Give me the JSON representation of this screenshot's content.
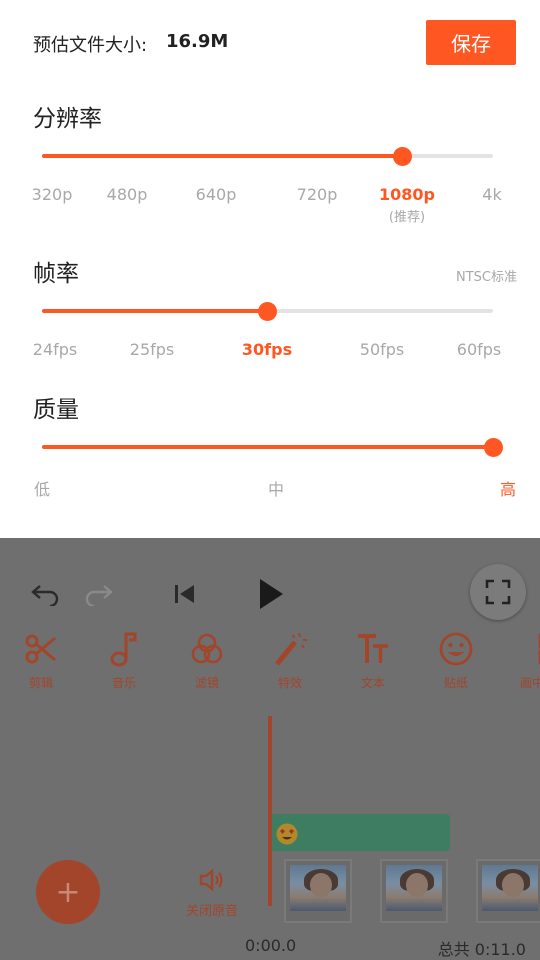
{
  "export": {
    "size_label": "预估文件大小:",
    "size_value": "16.9M",
    "save_label": "保存"
  },
  "resolution": {
    "title": "分辨率",
    "options": [
      "320p",
      "480p",
      "640p",
      "720p",
      "1080p",
      "4k"
    ],
    "selected": "1080p",
    "selected_note": "(推荐)",
    "level": 0.8
  },
  "framerate": {
    "title": "帧率",
    "note": "NTSC标准",
    "options": [
      "24fps",
      "25fps",
      "30fps",
      "50fps",
      "60fps"
    ],
    "selected": "30fps",
    "level": 0.5
  },
  "quality": {
    "title": "质量",
    "options": [
      "低",
      "中",
      "高"
    ],
    "selected": "高",
    "level": 1.0
  },
  "editor": {
    "tools": [
      {
        "label": "剪辑",
        "icon": "scissors-icon"
      },
      {
        "label": "音乐",
        "icon": "music-note-icon"
      },
      {
        "label": "滤镜",
        "icon": "filter-circles-icon"
      },
      {
        "label": "特效",
        "icon": "magic-wand-icon"
      },
      {
        "label": "文本",
        "icon": "text-icon"
      },
      {
        "label": "贴纸",
        "icon": "smiley-icon"
      },
      {
        "label": "画中",
        "icon": "picture-in-picture-icon"
      }
    ],
    "mute_label": "关闭原音",
    "add_label": "+",
    "current_time": "0:00.0",
    "total_time": "总共 0:11.0"
  },
  "colors": {
    "accent": "#ff5722",
    "inactive": "#a8a8a8",
    "track": "#e3e3e3",
    "dim_accent": "#a2452a",
    "sticker_track": "#3f7d62"
  }
}
